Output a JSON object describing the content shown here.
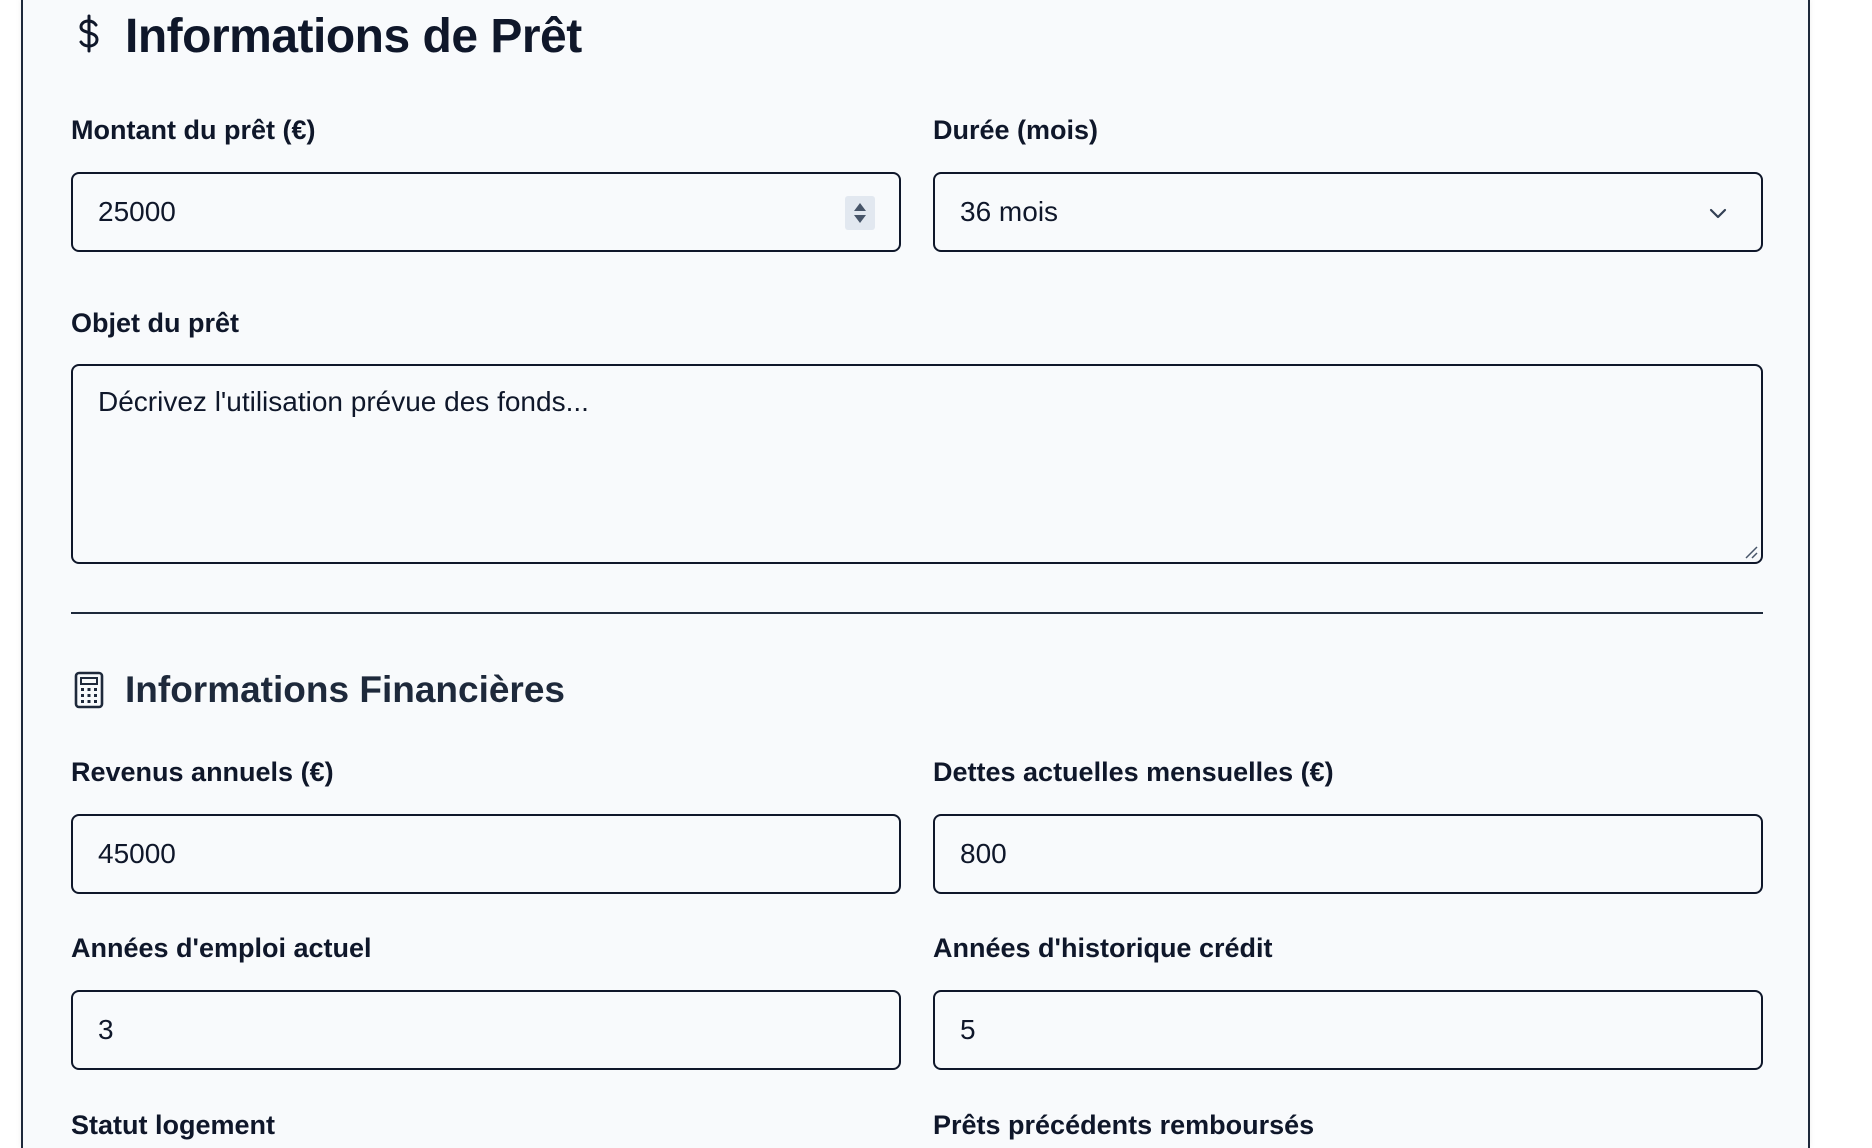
{
  "loan_section": {
    "title": "Informations de Prêt",
    "icon": "dollar-icon",
    "amount": {
      "label": "Montant du prêt (€)",
      "value": "25000"
    },
    "duration": {
      "label": "Durée (mois)",
      "selected": "36 mois"
    },
    "purpose": {
      "label": "Objet du prêt",
      "placeholder": "Décrivez l'utilisation prévue des fonds..."
    }
  },
  "financial_section": {
    "title": "Informations Financières",
    "icon": "calculator-icon",
    "annual_income": {
      "label": "Revenus annuels (€)",
      "value": "45000"
    },
    "monthly_debts": {
      "label": "Dettes actuelles mensuelles (€)",
      "value": "800"
    },
    "employment_years": {
      "label": "Années d'emploi actuel",
      "value": "3"
    },
    "credit_history_years": {
      "label": "Années d'historique crédit",
      "value": "5"
    },
    "housing_status": {
      "label": "Statut logement"
    },
    "previous_loans_repaid": {
      "label": "Prêts précédents remboursés"
    }
  }
}
